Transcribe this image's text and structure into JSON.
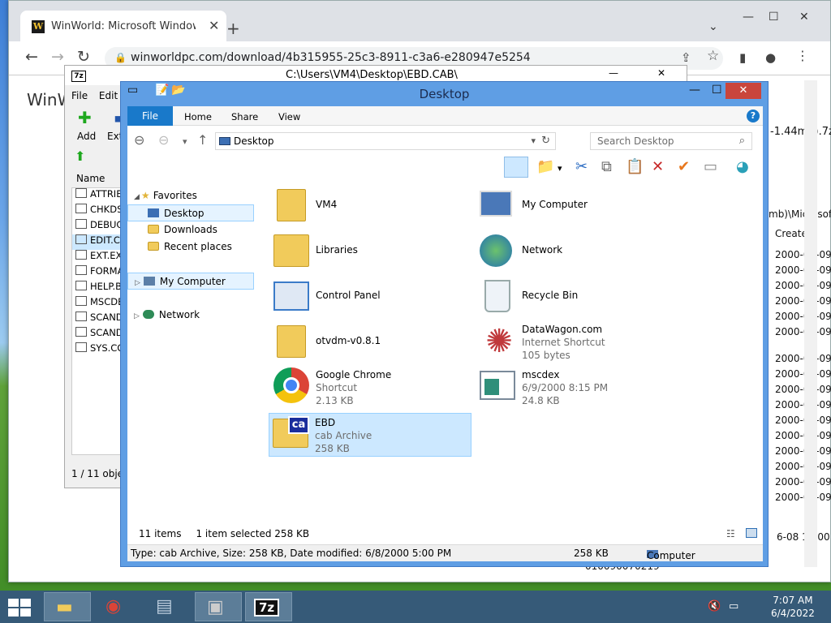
{
  "chrome": {
    "tab_title": "WinWorld: Microsoft Windows M",
    "url": "winworldpc.com/download/4b315955-25c3-8911-c3a6-e280947e5254",
    "brand": "WinW",
    "right_fragments": {
      "filename": "-1.44mb).7z",
      "path": "mb)\\Microsoft",
      "created_header": "Created",
      "bottom_date": "6-08 17:00:00",
      "bottom_code": "010090070219"
    },
    "created_dates": [
      "2000-06-09 20",
      "2000-06-09 20",
      "2000-06-09 20",
      "2000-06-09 20",
      "2000-06-09 20",
      "2000-06-09 20",
      "2000-06-09 20",
      "2000-06-09 20",
      "2000-06-09 20",
      "2000-06-09 20",
      "2000-06-09 20",
      "2000-06-09 20",
      "2000-06-09 20",
      "2000-06-09 20",
      "2000-06-09 20",
      "2000-06-09 20"
    ]
  },
  "zip": {
    "title": "C:\\Users\\VM4\\Desktop\\EBD.CAB\\",
    "menu": [
      "File",
      "Edit"
    ],
    "add_label": "Add",
    "extract_label": "Extr",
    "col_name": "Name",
    "files": [
      "ATTRIB",
      "CHKDS",
      "DEBUG",
      "EDIT.CO",
      "EXT.EXI",
      "FORMA",
      "HELP.B",
      "MSCDE",
      "SCAND",
      "SCAND",
      "SYS.CO"
    ],
    "status": "1 / 11 objec"
  },
  "explorer": {
    "title": "Desktop",
    "ribbon_tabs": [
      "File",
      "Home",
      "Share",
      "View"
    ],
    "address": "Desktop",
    "search_placeholder": "Search Desktop",
    "nav": {
      "favorites": "Favorites",
      "desktop": "Desktop",
      "downloads": "Downloads",
      "recent": "Recent places",
      "my_computer": "My Computer",
      "network": "Network"
    },
    "items": [
      {
        "name": "VM4",
        "sub": []
      },
      {
        "name": "My Computer",
        "sub": []
      },
      {
        "name": "Libraries",
        "sub": []
      },
      {
        "name": "Network",
        "sub": []
      },
      {
        "name": "Control Panel",
        "sub": []
      },
      {
        "name": "Recycle Bin",
        "sub": []
      },
      {
        "name": "otvdm-v0.8.1",
        "sub": []
      },
      {
        "name": "DataWagon.com",
        "sub": [
          "Internet Shortcut",
          "105 bytes"
        ]
      },
      {
        "name": "Google Chrome",
        "sub": [
          "Shortcut",
          "2.13 KB"
        ]
      },
      {
        "name": "mscdex",
        "sub": [
          "6/9/2000 8:15 PM",
          "24.8 KB"
        ]
      },
      {
        "name": "EBD",
        "sub": [
          "cab Archive",
          "258 KB"
        ]
      }
    ],
    "status": {
      "count": "11 items",
      "selected": "1 item selected  258 KB"
    },
    "details": {
      "info": "Type: cab Archive, Size: 258 KB, Date modified: 6/8/2000 5:00 PM",
      "size": "258 KB",
      "location": "Computer"
    }
  },
  "taskbar": {
    "time": "7:07 AM",
    "date": "6/4/2022",
    "sevenzip": "7z"
  }
}
